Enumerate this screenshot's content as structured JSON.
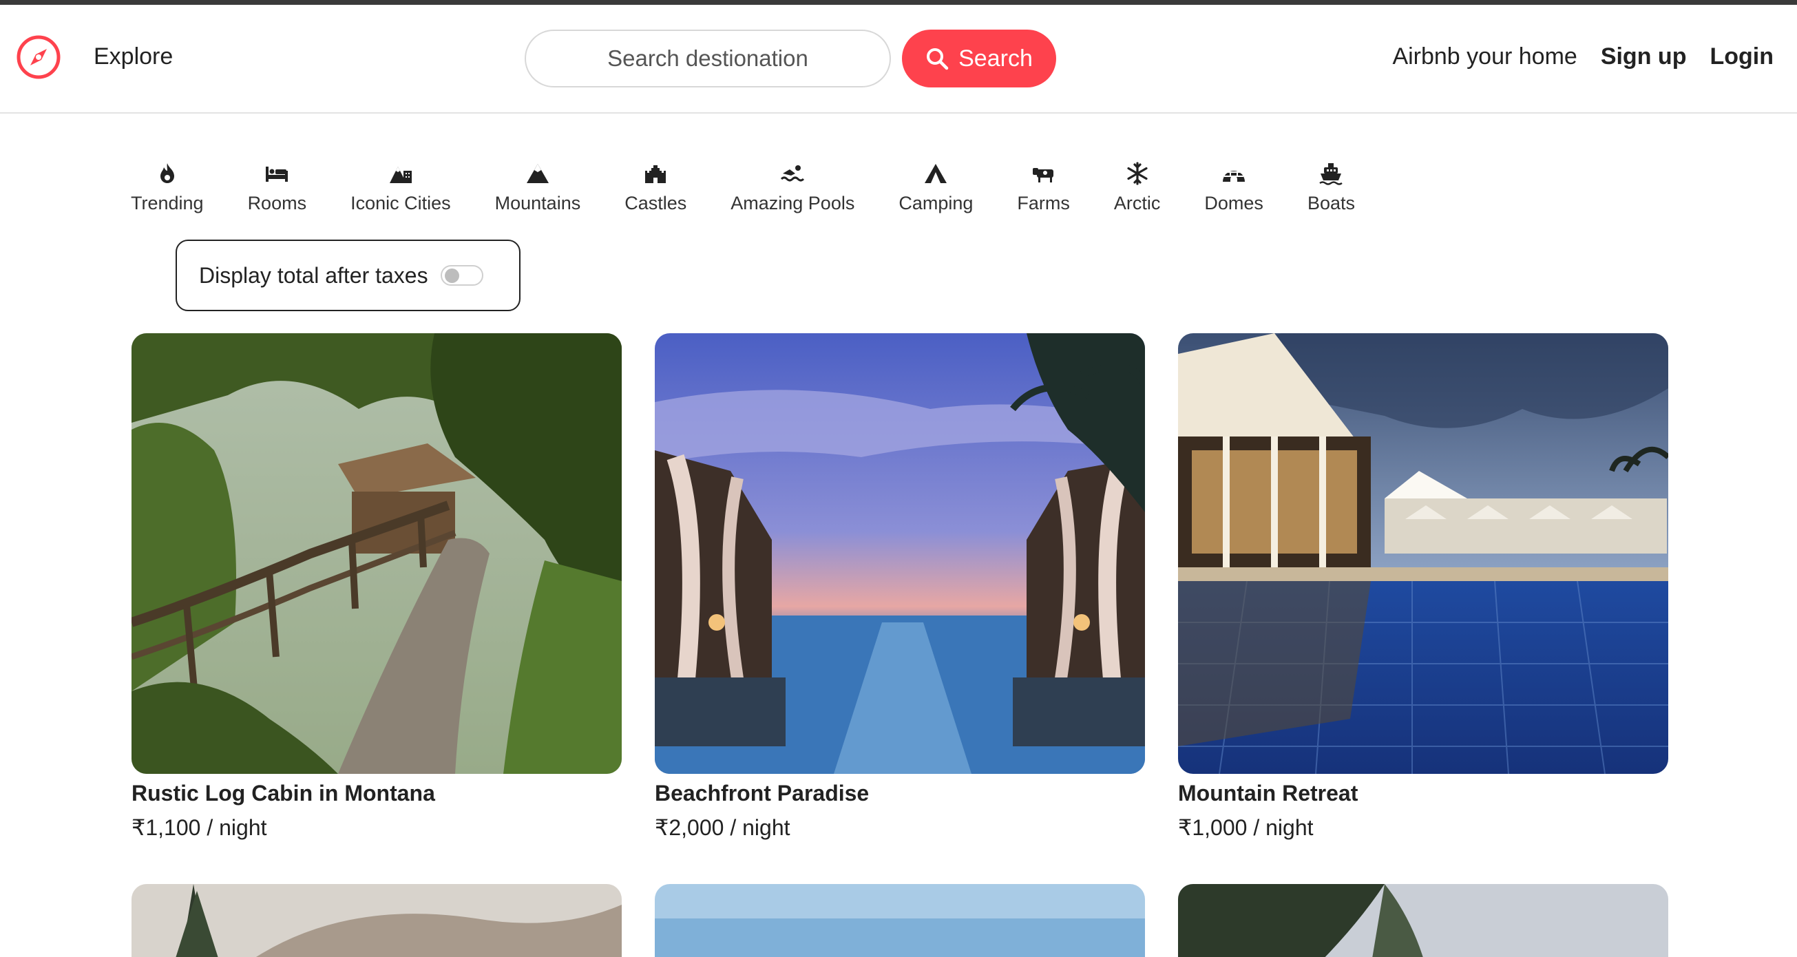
{
  "brand": {
    "accent": "#fe424d",
    "logo_icon": "compass-icon"
  },
  "nav": {
    "explore": "Explore",
    "search_placeholder": "Search destionation",
    "search_button": "Search",
    "airbnb_home": "Airbnb your home",
    "signup": "Sign up",
    "login": "Login"
  },
  "filters": [
    {
      "label": "Trending",
      "icon": "fire-icon"
    },
    {
      "label": "Rooms",
      "icon": "bed-icon"
    },
    {
      "label": "Iconic Cities",
      "icon": "city-mountain-icon"
    },
    {
      "label": "Mountains",
      "icon": "mountain-icon"
    },
    {
      "label": "Castles",
      "icon": "castle-icon"
    },
    {
      "label": "Amazing Pools",
      "icon": "swimmer-icon"
    },
    {
      "label": "Camping",
      "icon": "tent-icon"
    },
    {
      "label": "Farms",
      "icon": "cow-icon"
    },
    {
      "label": "Arctic",
      "icon": "snowflake-icon"
    },
    {
      "label": "Domes",
      "icon": "igloo-icon"
    },
    {
      "label": "Boats",
      "icon": "ship-icon"
    }
  ],
  "tax_toggle": {
    "label": "Display total after taxes",
    "enabled": false
  },
  "listings": [
    {
      "title": "Rustic Log Cabin in Montana",
      "price": "₹1,100 / night"
    },
    {
      "title": "Beachfront Paradise",
      "price": "₹2,000 / night"
    },
    {
      "title": "Mountain Retreat",
      "price": "₹1,000 / night"
    }
  ]
}
